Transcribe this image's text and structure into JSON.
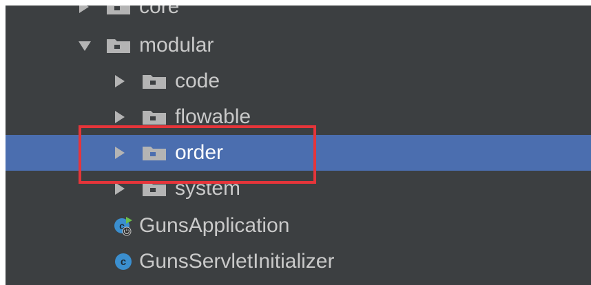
{
  "tree": {
    "items": [
      {
        "label": "core",
        "arrow": "right",
        "icon": "folder-icon"
      },
      {
        "label": "modular",
        "arrow": "down",
        "icon": "folder-icon"
      },
      {
        "label": "code",
        "arrow": "right",
        "icon": "folder-icon"
      },
      {
        "label": "flowable",
        "arrow": "right",
        "icon": "folder-icon"
      },
      {
        "label": "order",
        "arrow": "right",
        "icon": "folder-icon",
        "selected": true
      },
      {
        "label": "system",
        "arrow": "right",
        "icon": "folder-icon"
      },
      {
        "label": "GunsApplication",
        "icon": "spring-boot-class-icon"
      },
      {
        "label": "GunsServletInitializer",
        "icon": "java-class-icon"
      }
    ]
  },
  "colors": {
    "panel_background": "#3c3f41",
    "selection": "#4b6eaf",
    "text": "#c9c9c9",
    "highlight_box": "#e5353a",
    "folder": "#b4b4b4",
    "class_icon": "#3b8fcf"
  }
}
